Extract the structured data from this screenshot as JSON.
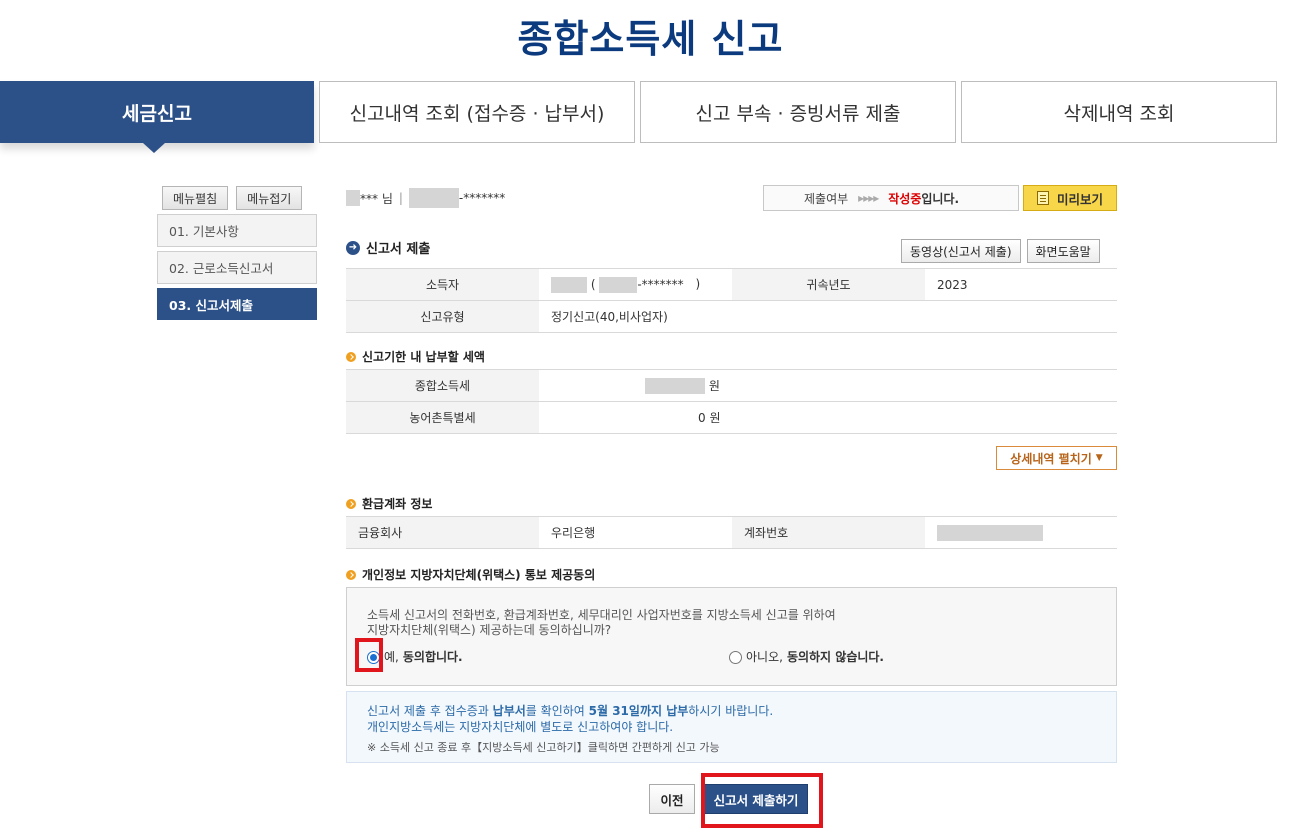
{
  "page_title": "종합소득세 신고",
  "tabs": [
    {
      "label": "세금신고",
      "active": true
    },
    {
      "label": "신고내역 조회 (접수증 · 납부서)",
      "active": false
    },
    {
      "label": "신고 부속 · 증빙서류 제출",
      "active": false
    },
    {
      "label": "삭제내역 조회",
      "active": false
    }
  ],
  "sidebar": {
    "expand_label": "메뉴펼침",
    "collapse_label": "메뉴접기",
    "items": [
      {
        "label": "01. 기본사항"
      },
      {
        "label": "02. 근로소득신고서"
      },
      {
        "label": "03. 신고서제출"
      }
    ]
  },
  "user": {
    "name_masked": "*** 님",
    "separator": "|",
    "id_masked": "-*******"
  },
  "status": {
    "label": "제출여부",
    "arrows": "▸▸▸▸",
    "value": "작성중",
    "suffix": "입니다."
  },
  "preview_label": "미리보기",
  "submission": {
    "title": "신고서 제출",
    "video_btn": "동영상(신고서 제출)",
    "help_btn": "화면도움말",
    "taxpayer_label": "소득자",
    "taxpayer_open": "(",
    "taxpayer_masked": "-*******",
    "taxpayer_close": ")",
    "year_label": "귀속년도",
    "year_value": "2023",
    "type_label": "신고유형",
    "type_value": "정기신고(40,비사업자)"
  },
  "tax_due": {
    "title": "신고기한 내 납부할 세액",
    "income_tax_label": "종합소득세",
    "income_tax_unit": "원",
    "rural_tax_label": "농어촌특별세",
    "rural_tax_value": "0 원",
    "detail_btn": "상세내역 펼치기",
    "detail_icon": "▼"
  },
  "refund": {
    "title": "환급계좌 정보",
    "bank_label": "금융회사",
    "bank_value": "우리은행",
    "account_label": "계좌번호"
  },
  "consent": {
    "title": "개인정보 지방자치단체(위택스) 통보 제공동의",
    "text_line1": "소득세 신고서의 전화번호, 환급계좌번호, 세무대리인 사업자번호를 지방소득세 신고를 위하여",
    "text_line2": "지방자치단체(위택스) 제공하는데 동의하십니까?",
    "yes_prefix": "예, ",
    "yes_bold": "동의합니다.",
    "no_prefix": "아니오, ",
    "no_bold": "동의하지 않습니다."
  },
  "notice": {
    "line1_a": "신고서 제출 후 접수증과 ",
    "line1_b": "납부서",
    "line1_c": "를 확인하여 ",
    "line1_d": "5월 31일까지 납부",
    "line1_e": "하시기 바랍니다.",
    "line2": "개인지방소득세는 지방자치단체에 별도로 신고하여야 합니다.",
    "line3": "※ 소득세 신고 종료 후【지방소득세 신고하기】클릭하면 간편하게 신고 가능"
  },
  "buttons": {
    "prev": "이전",
    "submit": "신고서 제출하기"
  }
}
